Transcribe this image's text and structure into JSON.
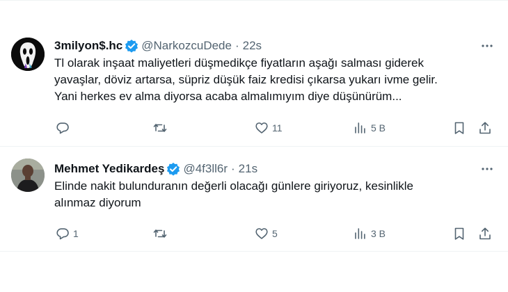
{
  "tweets": [
    {
      "display_name": "3milyon$.hc",
      "handle": "@NarkozcuDede",
      "separator": "·",
      "time": "22s",
      "text_lines": [
        "Tl olarak inşaat maliyetleri düşmedikçe fiyatların aşağı salması giderek",
        "yavaşlar, döviz artarsa, süpriz düşük faiz kredisi çıkarsa yukarı ivme gelir.",
        "Yani herkes ev alma diyorsa acaba almalımıyım diye düşünürüm..."
      ],
      "replies": "",
      "retweets": "",
      "likes": "11",
      "views": "5 B"
    },
    {
      "display_name": "Mehmet Yedikardeş",
      "handle": "@4f3ll6r",
      "separator": "·",
      "time": "21s",
      "text_lines": [
        "Elinde nakit bulunduranın değerli olacağı günlere giriyoruz, kesinlikle",
        "alınmaz diyorum"
      ],
      "replies": "1",
      "retweets": "",
      "likes": "5",
      "views": "3 B"
    }
  ],
  "colors": {
    "text": "#0f1419",
    "secondary": "#536471",
    "verified": "#1d9bf0",
    "divider": "#eff3f4"
  },
  "icons": [
    "scream-mask-avatar",
    "person-avatar",
    "verified-badge-icon",
    "more-icon",
    "reply-icon",
    "retweet-icon",
    "like-icon",
    "views-icon",
    "bookmark-icon",
    "share-icon"
  ]
}
